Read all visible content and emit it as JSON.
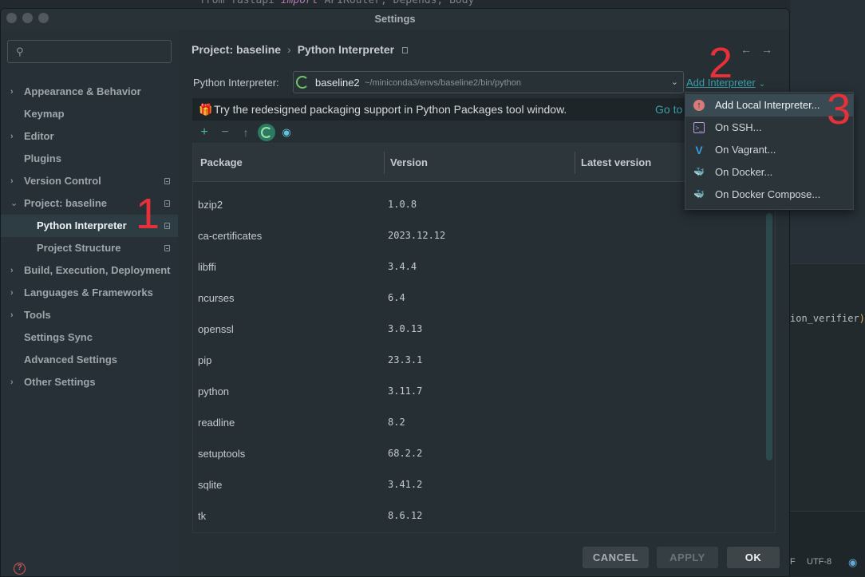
{
  "background": {
    "code_top": {
      "pre": "from fastapi ",
      "kw": "import",
      "post": " APIRouter, Depends, Body"
    },
    "code_right": {
      "text": "ion_verifier",
      "close": "))"
    },
    "status_encoding": "UTF-8",
    "status_f": "F"
  },
  "dialog": {
    "title": "Settings"
  },
  "sidebar": {
    "search_placeholder": "",
    "items": [
      {
        "label": "Appearance & Behavior",
        "chevron": "›"
      },
      {
        "label": "Keymap",
        "chevron": ""
      },
      {
        "label": "Editor",
        "chevron": "›"
      },
      {
        "label": "Plugins",
        "chevron": ""
      },
      {
        "label": "Version Control",
        "chevron": "›"
      },
      {
        "label": "Project: baseline",
        "chevron": "⌄"
      },
      {
        "label": "Python Interpreter",
        "chevron": ""
      },
      {
        "label": "Project Structure",
        "chevron": ""
      },
      {
        "label": "Build, Execution, Deployment",
        "chevron": "›"
      },
      {
        "label": "Languages & Frameworks",
        "chevron": "›"
      },
      {
        "label": "Tools",
        "chevron": "›"
      },
      {
        "label": "Settings Sync",
        "chevron": ""
      },
      {
        "label": "Advanced Settings",
        "chevron": ""
      },
      {
        "label": "Other Settings",
        "chevron": "›"
      }
    ],
    "help": "?"
  },
  "breadcrumb": {
    "project": "Project: baseline",
    "sep": "›",
    "page": "Python Interpreter"
  },
  "nav_arrows": "←→",
  "interpreter": {
    "label": "Python Interpreter:",
    "name": "baseline2",
    "path": "~/miniconda3/envs/baseline2/bin/python",
    "chevron": "⌄",
    "add_label": "Add Interpreter",
    "add_chevron": "⌄"
  },
  "banner": {
    "icon": "🎁",
    "text": "Try the redesigned packaging support in Python Packages tool window.",
    "link": "Go to"
  },
  "toolbar": {
    "plus": "+",
    "minus": "−",
    "up": "↑",
    "eye": "◉"
  },
  "table": {
    "headers": [
      "Package",
      "Version",
      "Latest version"
    ],
    "rows": [
      {
        "package": "bzip2",
        "version": "1.0.8"
      },
      {
        "package": "ca-certificates",
        "version": "2023.12.12"
      },
      {
        "package": "libffi",
        "version": "3.4.4"
      },
      {
        "package": "ncurses",
        "version": "6.4"
      },
      {
        "package": "openssl",
        "version": "3.0.13"
      },
      {
        "package": "pip",
        "version": "23.3.1"
      },
      {
        "package": "python",
        "version": "3.11.7"
      },
      {
        "package": "readline",
        "version": "8.2"
      },
      {
        "package": "setuptools",
        "version": "68.2.2"
      },
      {
        "package": "sqlite",
        "version": "3.41.2"
      },
      {
        "package": "tk",
        "version": "8.6.12"
      }
    ]
  },
  "buttons": {
    "cancel": "CANCEL",
    "apply": "APPLY",
    "ok": "OK"
  },
  "dropdown": {
    "items": [
      {
        "label": "Add Local Interpreter...",
        "icon": "add-local-interpreter-icon",
        "glyph": "↑"
      },
      {
        "label": "On SSH...",
        "icon": "ssh-icon",
        "glyph": ">_"
      },
      {
        "label": "On Vagrant...",
        "icon": "vagrant-icon",
        "glyph": "V"
      },
      {
        "label": "On Docker...",
        "icon": "docker-icon",
        "glyph": "🐳"
      },
      {
        "label": "On Docker Compose...",
        "icon": "docker-compose-icon",
        "glyph": "🐳"
      }
    ]
  },
  "annotations": [
    "1",
    "2",
    "3"
  ],
  "colors": {
    "accent_link": "#3d9ea9",
    "annotation_red": "#e8303a",
    "selection_bg": "#2e3c44"
  }
}
